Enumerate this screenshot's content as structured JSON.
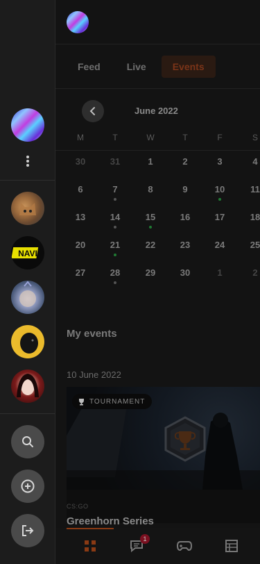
{
  "tabs": [
    {
      "label": "Feed"
    },
    {
      "label": "Live"
    },
    {
      "label": "Events"
    }
  ],
  "active_tab": "Events",
  "calendar": {
    "month_label": "June 2022",
    "weekdays": [
      "M",
      "T",
      "W",
      "T",
      "F",
      "S"
    ],
    "weeks": [
      [
        "30",
        "31",
        "1",
        "2",
        "3",
        "4"
      ],
      [
        "6",
        "7",
        "8",
        "9",
        "10",
        "11"
      ],
      [
        "13",
        "14",
        "15",
        "16",
        "17",
        "18"
      ],
      [
        "20",
        "21",
        "22",
        "23",
        "24",
        "25"
      ],
      [
        "27",
        "28",
        "29",
        "30",
        "1",
        "2"
      ]
    ]
  },
  "my_events": {
    "title": "My events",
    "date": "10 June 2022",
    "card": {
      "tag": "TOURNAMENT",
      "game": "CS:GO",
      "title": "Greenhorn Series"
    }
  },
  "notifications_badge": "1",
  "colors": {
    "accent": "#c85a1e",
    "event_dot_green": "#2ecc40",
    "badge_red": "#d0143c"
  }
}
